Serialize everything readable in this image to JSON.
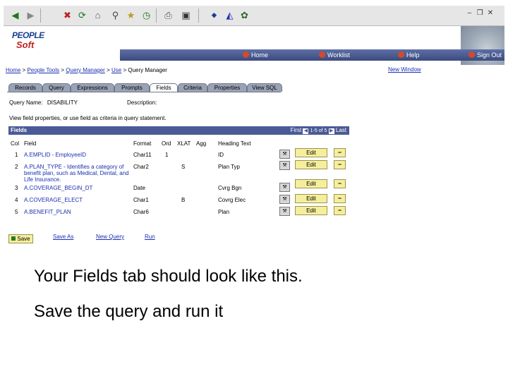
{
  "window": {
    "controls": [
      "–",
      "❐",
      "✕"
    ]
  },
  "brand": {
    "logo_line1": "PEOPLE",
    "logo_line2": "Soft"
  },
  "nav": {
    "items": [
      {
        "label": "Home",
        "icon": "home-icon"
      },
      {
        "label": "Worklist",
        "icon": "worklist-icon"
      },
      {
        "label": "Help",
        "icon": "help-icon"
      },
      {
        "label": "Sign Out",
        "icon": "signout-icon"
      }
    ]
  },
  "breadcrumb": {
    "items": [
      "Home",
      "People Tools",
      "Query Manager",
      "Use",
      "Query Manager"
    ],
    "separator": " > "
  },
  "new_window": "New Window",
  "tabs": [
    {
      "label": "Records",
      "active": false
    },
    {
      "label": "Query",
      "active": false
    },
    {
      "label": "Expressions",
      "active": false
    },
    {
      "label": "Prompts",
      "active": false
    },
    {
      "label": "Fields",
      "active": true
    },
    {
      "label": "Criteria",
      "active": false
    },
    {
      "label": "Properties",
      "active": false
    },
    {
      "label": "View SQL",
      "active": false
    }
  ],
  "query": {
    "name_label": "Query Name:",
    "name_value": "DISABILITY",
    "desc_label": "Description:"
  },
  "instruction": "View field properties, or use field as criteria in query statement.",
  "grid": {
    "title": "Fields",
    "nav": {
      "first": "First",
      "range": "1-5 of 5",
      "last": "Last"
    },
    "columns": [
      "Col",
      "Field",
      "Format",
      "Ord",
      "XLAT",
      "Agg",
      "Heading Text"
    ],
    "rows": [
      {
        "col": "1",
        "field": "A.EMPLID - EmployeeID",
        "format": "Char11",
        "ord": "1",
        "xlat": "",
        "agg": "",
        "heading": "ID"
      },
      {
        "col": "2",
        "field": "A.PLAN_TYPE - Identifies a category of benefit plan, such as Medical, Dental, and Life Insurance.",
        "format": "Char2",
        "ord": "",
        "xlat": "S",
        "agg": "",
        "heading": "Plan Typ"
      },
      {
        "col": "3",
        "field": "A.COVERAGE_BEGIN_DT",
        "format": "Date",
        "ord": "",
        "xlat": "",
        "agg": "",
        "heading": "Cvrg Bgn"
      },
      {
        "col": "4",
        "field": "A.COVERAGE_ELECT",
        "format": "Char1",
        "ord": "",
        "xlat": "B",
        "agg": "",
        "heading": "Covrg Elec"
      },
      {
        "col": "5",
        "field": "A.BENEFIT_PLAN",
        "format": "Char6",
        "ord": "",
        "xlat": "",
        "agg": "",
        "heading": "Plan"
      }
    ],
    "edit_label": "Edit",
    "remove_label": "−"
  },
  "actions": {
    "save": "Save",
    "save_as": "Save As",
    "new_query": "New Query",
    "run": "Run"
  },
  "captions": [
    "Your Fields tab should look like this.",
    "Save the query and run it"
  ],
  "colors": {
    "grid_header": "#4a5a96",
    "navbar": "#3c4a7e",
    "link": "#1a2fb0",
    "button": "#f5ef9c"
  }
}
